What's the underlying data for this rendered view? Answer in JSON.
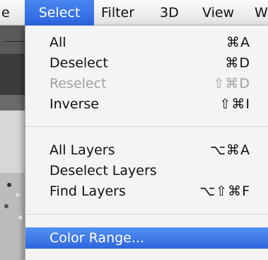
{
  "menubar": {
    "items": [
      {
        "label": "e"
      },
      {
        "label": "Select"
      },
      {
        "label": "Filter"
      },
      {
        "label": "3D"
      },
      {
        "label": "View"
      },
      {
        "label": "W"
      }
    ]
  },
  "menu": {
    "items": [
      {
        "label": "All",
        "shortcut": "⌘A"
      },
      {
        "label": "Deselect",
        "shortcut": "⌘D"
      },
      {
        "label": "Reselect",
        "shortcut": "⇧⌘D"
      },
      {
        "label": "Inverse",
        "shortcut": "⇧⌘I"
      },
      {
        "label": "All Layers",
        "shortcut": "⌥⌘A"
      },
      {
        "label": "Deselect Layers",
        "shortcut": ""
      },
      {
        "label": "Find Layers",
        "shortcut": "⌥⇧⌘F"
      },
      {
        "label": "Color Range..."
      }
    ]
  },
  "colors": {
    "highlight": "#3a78ea",
    "menu_bg": "#f4f4f4",
    "disabled_text": "#a0a0a0"
  }
}
